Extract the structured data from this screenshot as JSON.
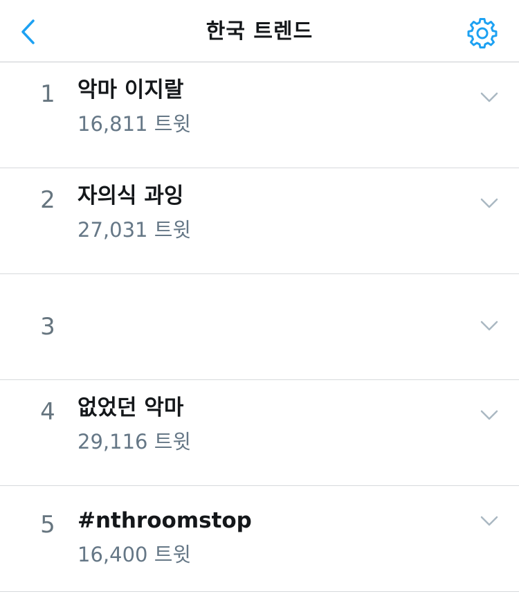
{
  "header": {
    "title": "한국 트렌드",
    "back_icon": "chevron-left-icon",
    "settings_icon": "gear-icon",
    "accent_color": "#1da1f2"
  },
  "trends": [
    {
      "rank": "1",
      "name": "악마 이지랄",
      "count": "16,811 트윗"
    },
    {
      "rank": "2",
      "name": "자의식 과잉",
      "count": "27,031 트윗"
    },
    {
      "rank": "3",
      "name": "",
      "count": ""
    },
    {
      "rank": "4",
      "name": "없었던 악마",
      "count": "29,116 트윗"
    },
    {
      "rank": "5",
      "name": "#nthroomstop",
      "count": "16,400 트윗"
    }
  ],
  "colors": {
    "text_primary": "#14171a",
    "text_secondary": "#657786",
    "divider": "#d6d9dc",
    "chevron": "#aab8c2"
  }
}
